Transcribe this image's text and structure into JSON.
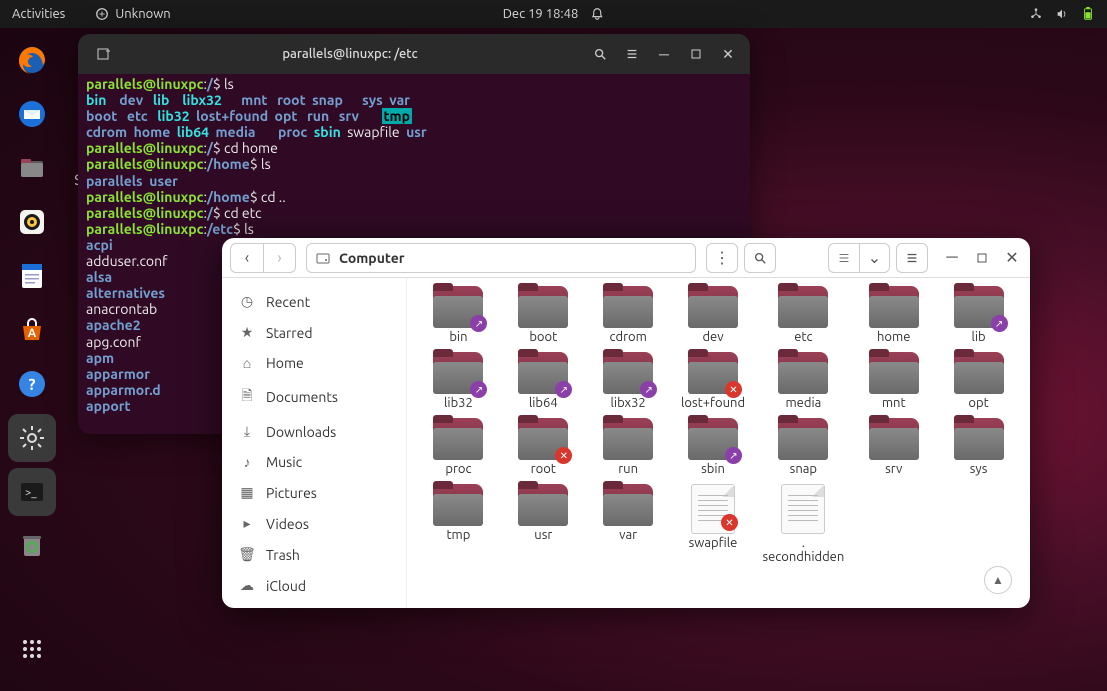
{
  "topbar": {
    "activities": "Activities",
    "app_indicator": "Unknown",
    "datetime": "Dec 19  18:48"
  },
  "dock": {
    "items": [
      {
        "name": "firefox"
      },
      {
        "name": "thunderbird"
      },
      {
        "name": "files"
      },
      {
        "name": "rhythmbox"
      },
      {
        "name": "libreoffice-writer"
      },
      {
        "name": "software-store"
      },
      {
        "name": "help"
      },
      {
        "name": "settings"
      },
      {
        "name": "terminal"
      },
      {
        "name": "trash"
      }
    ]
  },
  "terminal": {
    "title": "parallels@linuxpc: /etc",
    "prompt_host": "parallels@linuxpc",
    "lines": [
      {
        "p": "/",
        "cmd": "ls"
      },
      {
        "cols": [
          [
            "bin",
            "dev",
            "lib",
            "libx32",
            "mnt",
            "root",
            "snap",
            "sys",
            "var"
          ],
          [
            "boot",
            "etc",
            "lib32",
            "lost+found",
            "opt",
            "run",
            "srv",
            "tmp",
            ""
          ],
          [
            "cdrom",
            "home",
            "lib64",
            "media",
            "proc",
            "sbin",
            "swapfile",
            "usr",
            ""
          ]
        ]
      },
      {
        "p": "/",
        "cmd": "cd home"
      },
      {
        "p": "/home",
        "cmd": "ls"
      },
      {
        "out": "parallels  user",
        "class": "dir"
      },
      {
        "p": "/home",
        "cmd": "cd .."
      },
      {
        "p": "/",
        "cmd": "cd etc"
      },
      {
        "p": "/etc",
        "cmd": "ls"
      },
      {
        "etclist": [
          "acpi",
          "adduser.conf",
          "alsa",
          "alternatives",
          "anacrontab",
          "apache2",
          "apg.conf",
          "apm",
          "apparmor",
          "apparmor.d",
          "apport"
        ]
      }
    ],
    "etc_ls_colors": {
      "acpi": "dir",
      "adduser.conf": "file",
      "alsa": "dir",
      "alternatives": "dir",
      "anacrontab": "file",
      "apache2": "dir",
      "apg.conf": "file",
      "apm": "dir",
      "apparmor": "dir",
      "apparmor.d": "dir",
      "apport": "dir"
    },
    "root_ls_colors": {
      "bin": "link",
      "dev": "dir",
      "lib": "link",
      "libx32": "link",
      "mnt": "dir",
      "root": "dir",
      "snap": "dir",
      "sys": "dir",
      "var": "dir",
      "boot": "dir",
      "etc": "dir",
      "lib32": "link",
      "lost+found": "dir",
      "opt": "dir",
      "run": "dir",
      "srv": "dir",
      "tmp": "tmp",
      "cdrom": "dir",
      "home": "dir",
      "lib64": "link",
      "media": "dir",
      "proc": "dir",
      "sbin": "link",
      "swapfile": "file",
      "usr": "dir"
    }
  },
  "files": {
    "location_label": "Computer",
    "sidebar": [
      {
        "icon": "clock",
        "label": "Recent"
      },
      {
        "icon": "star",
        "label": "Starred"
      },
      {
        "icon": "home",
        "label": "Home"
      },
      {
        "icon": "doc",
        "label": "Documents"
      },
      {
        "icon": "down",
        "label": "Downloads"
      },
      {
        "icon": "music",
        "label": "Music"
      },
      {
        "icon": "pic",
        "label": "Pictures"
      },
      {
        "icon": "video",
        "label": "Videos"
      },
      {
        "icon": "trash",
        "label": "Trash"
      },
      {
        "icon": "cloud",
        "label": "iCloud"
      }
    ],
    "items": [
      {
        "name": "bin",
        "type": "folder",
        "badge": "link"
      },
      {
        "name": "boot",
        "type": "folder"
      },
      {
        "name": "cdrom",
        "type": "folder"
      },
      {
        "name": "dev",
        "type": "folder"
      },
      {
        "name": "etc",
        "type": "folder"
      },
      {
        "name": "home",
        "type": "folder"
      },
      {
        "name": "lib",
        "type": "folder",
        "badge": "link"
      },
      {
        "name": "lib32",
        "type": "folder",
        "badge": "link"
      },
      {
        "name": "lib64",
        "type": "folder",
        "badge": "link"
      },
      {
        "name": "libx32",
        "type": "folder",
        "badge": "link"
      },
      {
        "name": "lost+found",
        "type": "folder",
        "badge": "lock"
      },
      {
        "name": "media",
        "type": "folder"
      },
      {
        "name": "mnt",
        "type": "folder"
      },
      {
        "name": "opt",
        "type": "folder"
      },
      {
        "name": "proc",
        "type": "folder"
      },
      {
        "name": "root",
        "type": "folder",
        "badge": "lock"
      },
      {
        "name": "run",
        "type": "folder"
      },
      {
        "name": "sbin",
        "type": "folder",
        "badge": "link"
      },
      {
        "name": "snap",
        "type": "folder"
      },
      {
        "name": "srv",
        "type": "folder"
      },
      {
        "name": "sys",
        "type": "folder"
      },
      {
        "name": "tmp",
        "type": "folder"
      },
      {
        "name": "usr",
        "type": "folder"
      },
      {
        "name": "var",
        "type": "folder"
      },
      {
        "name": "swapfile",
        "type": "file",
        "badge": "lock"
      },
      {
        "name": ". secondhidden",
        "type": "file"
      }
    ]
  }
}
